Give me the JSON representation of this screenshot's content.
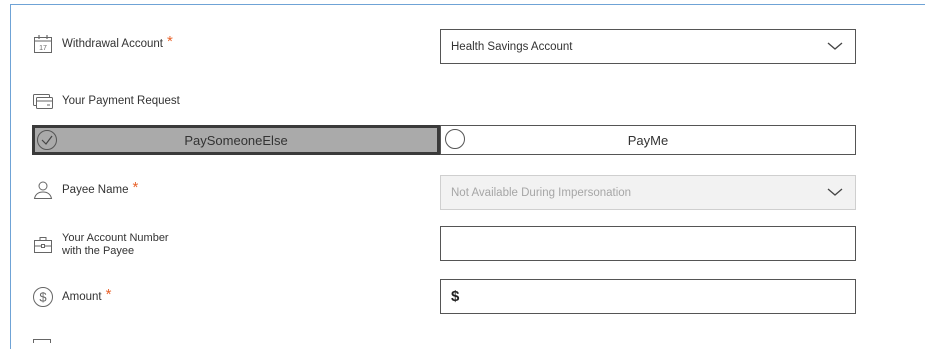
{
  "form": {
    "withdrawal": {
      "label": "Withdrawal Account",
      "required_mark": "*",
      "icon": "calendar-icon",
      "calendar_day": "17",
      "value": "Health Savings Account"
    },
    "payment_request": {
      "label": "Your Payment Request",
      "icon": "card-icon",
      "options": [
        {
          "label": "PaySomeoneElse",
          "selected": true
        },
        {
          "label": "PayMe",
          "selected": false
        }
      ]
    },
    "payee": {
      "label": "Payee Name",
      "required_mark": "*",
      "icon": "person-icon",
      "value": "Not Available During Impersonation",
      "disabled": true
    },
    "account_number": {
      "label_line1": "Your Account Number",
      "label_line2": "with the Payee",
      "icon": "briefcase-icon",
      "value": ""
    },
    "amount": {
      "label": "Amount",
      "required_mark": "*",
      "icon": "dollar-circle-icon",
      "value": "$"
    }
  },
  "colors": {
    "accent_required": "#e8632b",
    "frame_border": "#6fa3d6",
    "selected_option_bg": "#aaaaaa"
  }
}
